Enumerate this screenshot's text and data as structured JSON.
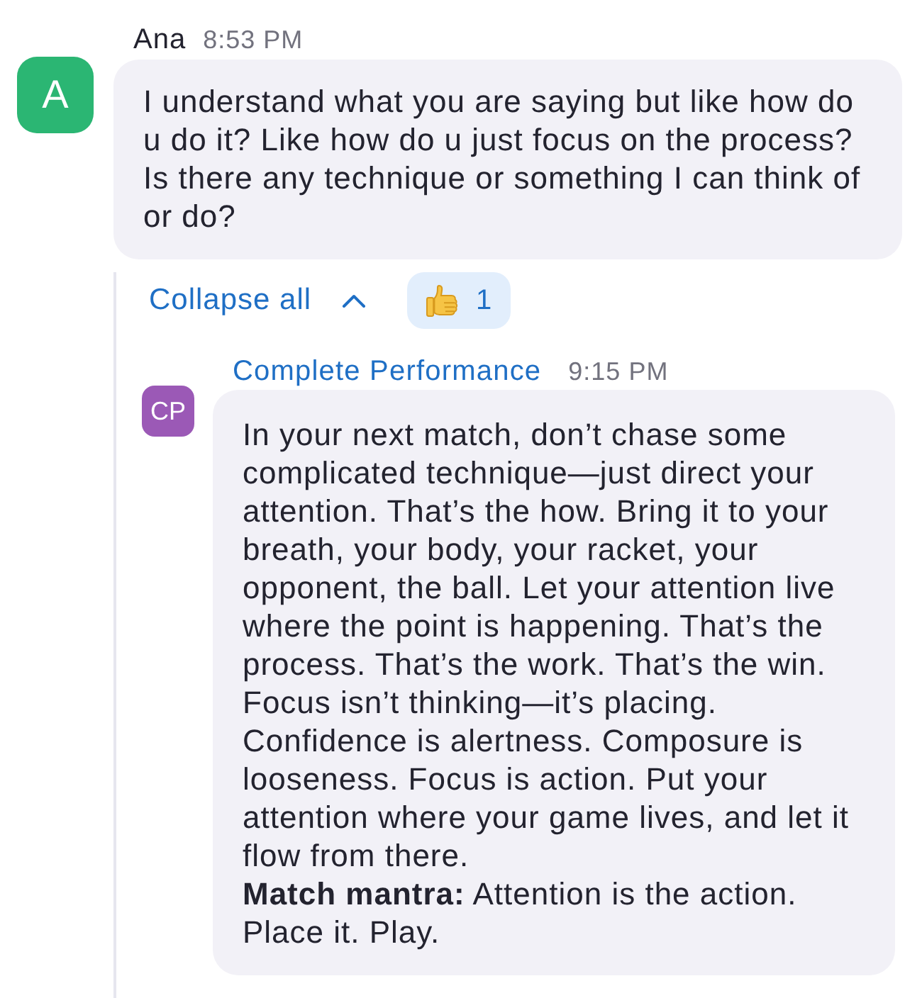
{
  "messages": [
    {
      "sender": "Ana",
      "time": "8:53 PM",
      "avatar": {
        "initials": "A",
        "color": "#2bb673"
      },
      "paragraphs": [
        "I understand what you are saying but like how do u do it? Like how do u just focus on the process? Is there any technique or something I can think of or do?"
      ]
    }
  ],
  "thread": {
    "collapse_label": "Collapse all",
    "reactions": [
      {
        "count": "1",
        "selected": true
      }
    ],
    "replies": [
      {
        "sender": "Complete Performance",
        "time": "9:15 PM",
        "avatar": {
          "initials": "CP",
          "color": "#9b59b6"
        },
        "paragraphs": [
          "In your next match, don’t chase some complicated technique—just direct your attention. That’s the how. Bring it to your breath, your body, your racket, your opponent, the ball. Let your attention live where the point is happening. That’s the process. That’s the work. That’s the win. Focus isn’t thinking—it’s placing. Confidence is alertness. Composure is looseness. Focus is action. Put your attention where your game lives, and let it flow from there.",
          "**Match mantra:** Attention is the action. Place it. Play."
        ]
      }
    ]
  }
}
